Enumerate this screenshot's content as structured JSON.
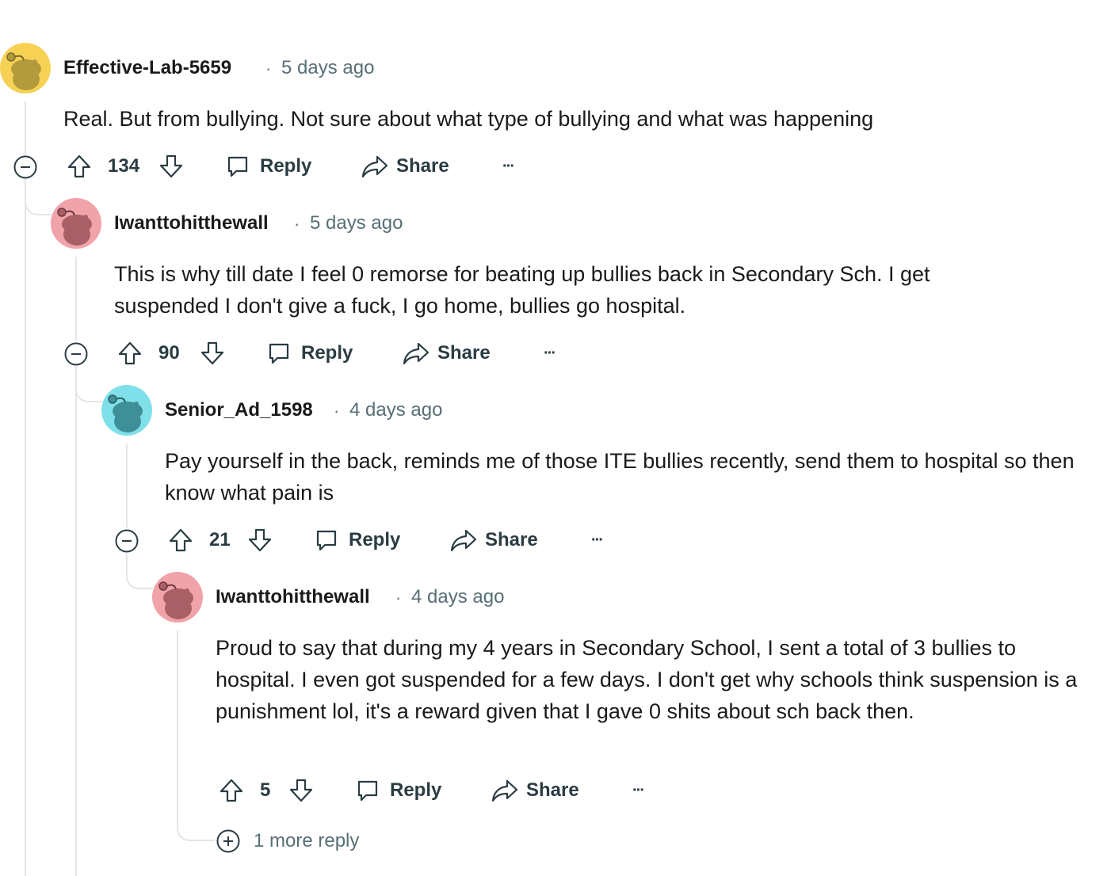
{
  "comments": [
    {
      "author": "Effective-Lab-5659",
      "separator": "·",
      "time": "5 days ago",
      "text": "Real. But from bullying. Not sure about what type of bullying and what was happening",
      "score": "134",
      "reply_label": "Reply",
      "share_label": "Share",
      "more_label": "···",
      "avatar_color": "#f7d154"
    },
    {
      "author": "Iwanttohitthewall",
      "separator": "·",
      "time": "5 days ago",
      "text": "This is why till date I feel 0 remorse for beating up bullies back in Secondary Sch. I get suspended I don't give a fuck, I go home, bullies go hospital.",
      "score": "90",
      "reply_label": "Reply",
      "share_label": "Share",
      "more_label": "···",
      "avatar_color": "#f0a3a9"
    },
    {
      "author": "Senior_Ad_1598",
      "separator": "·",
      "time": "4 days ago",
      "text": "Pay yourself in the back, reminds me of those ITE bullies recently, send them to hospital so then know what pain is",
      "score": "21",
      "reply_label": "Reply",
      "share_label": "Share",
      "more_label": "···",
      "avatar_color": "#7fe0ea"
    },
    {
      "author": "Iwanttohitthewall",
      "separator": "·",
      "time": "4 days ago",
      "text": "Proud to say that during my 4 years in Secondary School, I sent a total of 3 bullies to hospital. I even got suspended for a few days. I don't get why schools think suspension is a punishment lol, it's a reward given that I gave 0 shits about sch back then.",
      "score": "5",
      "reply_label": "Reply",
      "share_label": "Share",
      "more_label": "···",
      "avatar_color": "#f0a3a9"
    }
  ],
  "more_replies": "1 more reply",
  "colors": {
    "thread_line": "#e3e6e8",
    "meta_text": "#576f76",
    "action_text": "#2a3c42"
  }
}
